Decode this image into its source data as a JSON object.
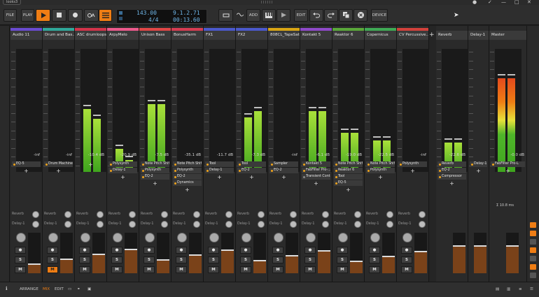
{
  "window": {
    "tab_label": "looks3",
    "controls": [
      "●",
      "✓",
      "—",
      "□",
      "✕"
    ]
  },
  "toolbar": {
    "file": "FILE",
    "play": "PLAY",
    "add": "ADD",
    "edit": "EDIT",
    "device": "DEVICE"
  },
  "display": {
    "tempo": "143.00",
    "signature": "4/4",
    "position": "9.1.2.71",
    "time": "00:13.60"
  },
  "strips": [
    {
      "name": "Audio 11",
      "color": "#6a4bd0",
      "db": "-inf",
      "meter_l": 0,
      "meter_r": 0,
      "devices": [
        {
          "label": "EQ-5",
          "on": true
        }
      ],
      "sends": [
        "Reverb",
        "Delay-1"
      ],
      "arm": false
    },
    {
      "name": "Drum and Bas...",
      "color": "#2fa89a",
      "db": "-inf",
      "meter_l": 0,
      "meter_r": 0,
      "devices": [
        {
          "label": "Drum Machine",
          "on": true
        }
      ],
      "sends": [
        "Reverb",
        "Delay-1"
      ],
      "arm": true
    },
    {
      "name": "ASC drumloops",
      "color": "#d2334a",
      "db": "-10.4 dB",
      "meter_l": 0.58,
      "meter_r": 0.49,
      "devices": [],
      "sends": [
        "Reverb",
        "Delay-1"
      ],
      "arm": false
    },
    {
      "name": "ArpyMelo",
      "color": "#ec5a8c",
      "db": "-20.9 dB",
      "meter_l": 0.21,
      "meter_r": 0.11,
      "devices": [
        {
          "label": "Polysynth",
          "on": true
        },
        {
          "label": "Delay-1",
          "on": true
        }
      ],
      "sends": [
        "Reverb",
        "Delay-1"
      ],
      "arm": false
    },
    {
      "name": "Unison Bass",
      "color": "#e04646",
      "db": "-7.5 dB",
      "meter_l": 0.62,
      "meter_r": 0.62,
      "devices": [
        {
          "label": "Note Pitch Shif...",
          "on": true
        },
        {
          "label": "Polysynth",
          "on": true
        },
        {
          "label": "EQ-2",
          "on": true
        }
      ],
      "sends": [
        "Reverb",
        "Delay-1"
      ],
      "arm": false
    },
    {
      "name": "BonusHarm",
      "color": "#d63c52",
      "db": "-35.1 dB",
      "meter_l": 0.04,
      "meter_r": 0.04,
      "devices": [
        {
          "label": "Note Pitch Shif...",
          "on": true
        },
        {
          "label": "Polysynth",
          "on": true
        },
        {
          "label": "EQ-2",
          "on": true
        },
        {
          "label": "Dynamics",
          "on": true
        }
      ],
      "sends": [
        "Reverb",
        "Delay-1"
      ],
      "arm": false
    },
    {
      "name": "FX1",
      "color": "#4b59cc",
      "db": "-11.7 dB",
      "meter_l": 0,
      "meter_r": 0,
      "devices": [
        {
          "label": "Tool",
          "on": true
        },
        {
          "label": "Delay-1",
          "on": true
        }
      ],
      "sends": [
        "Reverb",
        "Delay-1"
      ],
      "arm": false
    },
    {
      "name": "FX2",
      "color": "#4b59cc",
      "db": "-7.3 dB",
      "meter_l": 0.5,
      "meter_r": 0.56,
      "devices": [
        {
          "label": "Tool",
          "on": true
        },
        {
          "label": "EQ-2",
          "on": true
        }
      ],
      "sends": [
        "Reverb",
        "Delay-1"
      ],
      "arm": false
    },
    {
      "name": "808CL_TapeSat",
      "color": "#d9a514",
      "db": "-inf",
      "meter_l": 0,
      "meter_r": 0,
      "devices": [
        {
          "label": "Sampler",
          "on": true
        },
        {
          "label": "EQ-2",
          "on": true
        }
      ],
      "sends": [
        "Reverb",
        "Delay-1"
      ],
      "arm": false
    },
    {
      "name": "Kontakt 5",
      "color": "#8f49c9",
      "db": "-6.1 dB",
      "meter_l": 0.56,
      "meter_r": 0.56,
      "devices": [
        {
          "label": "Kontakt 5",
          "on": true
        },
        {
          "label": "FabFilter Pro-...",
          "on": true
        },
        {
          "label": "Transient Cont...",
          "on": false
        }
      ],
      "sends": [
        "Reverb",
        "Delay-1"
      ],
      "arm": false
    },
    {
      "name": "Reaktor 6",
      "color": "#5aa83a",
      "db": "-19.0 dB",
      "meter_l": 0.36,
      "meter_r": 0.36,
      "devices": [
        {
          "label": "Note Pitch Shif...",
          "on": true
        },
        {
          "label": "Reaktor 6",
          "on": true
        },
        {
          "label": "Tool",
          "on": true
        },
        {
          "label": "EQ-5",
          "on": true
        }
      ],
      "sends": [
        "Reverb",
        "Delay-1"
      ],
      "arm": false
    },
    {
      "name": "Copernicus",
      "color": "#3faa55",
      "db": "-22.5 dB",
      "meter_l": 0.29,
      "meter_r": 0.29,
      "devices": [
        {
          "label": "Note Pitch Shif...",
          "on": true
        },
        {
          "label": "Polysynth",
          "on": true
        }
      ],
      "sends": [
        "Reverb",
        "Delay-1"
      ],
      "arm": false
    },
    {
      "name": "CV Percussive...",
      "color": "#d3413b",
      "db": "-inf",
      "meter_l": 0,
      "meter_r": 0,
      "devices": [
        {
          "label": "Polysynth",
          "on": true
        }
      ],
      "sends": [
        "Reverb",
        "Delay-1"
      ],
      "arm": false
    }
  ],
  "fx_strips": [
    {
      "name": "Reverb",
      "db": "-22.6 dB",
      "meter_l": 0.27,
      "meter_r": 0.27,
      "devices": [
        {
          "label": "Reverb",
          "on": true
        },
        {
          "label": "EQ-2",
          "on": true
        },
        {
          "label": "Compressor",
          "on": true
        }
      ]
    },
    {
      "name": "Delay-1",
      "db": "",
      "meter_l": 0,
      "meter_r": 0,
      "devices": [
        {
          "label": "Delay-1",
          "on": true
        }
      ]
    },
    {
      "name": "Master",
      "db": "-0.0 dB",
      "meter_l": 0.86,
      "meter_r": 0.86,
      "devices": [
        {
          "label": "FabFilter Pro-L",
          "on": true
        }
      ],
      "latency": "Σ 10.8 ms"
    }
  ],
  "scale_labels": [
    "0",
    "6",
    "12",
    "18",
    "24",
    "30",
    "36",
    "42",
    "48",
    "54",
    "60",
    "66",
    "72",
    "∞"
  ],
  "status": {
    "arrange": "ARRANGE",
    "mix": "MIX",
    "edit": "EDIT",
    "accent": "#ef7d14"
  }
}
